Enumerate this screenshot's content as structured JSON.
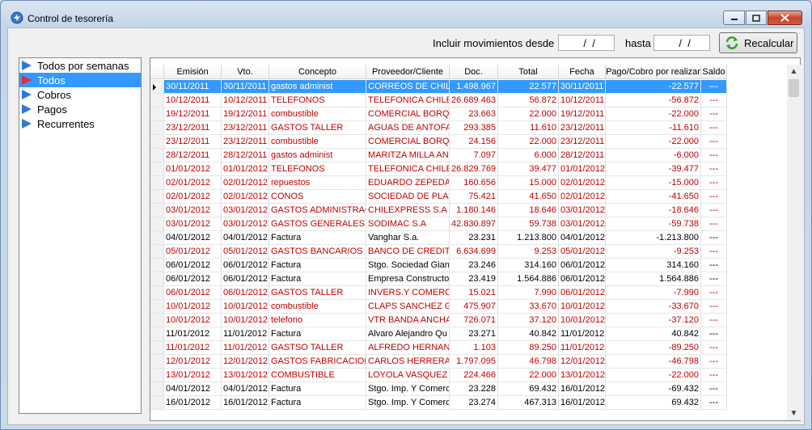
{
  "window": {
    "title": "Control de tesorería",
    "minimize_label": "▁",
    "maximize_label": "□",
    "close_label": "✕"
  },
  "filters": {
    "from_label": "Incluir movimientos desde",
    "from_value": "  /  /",
    "to_label": "hasta",
    "to_value": "  /  /",
    "recalc_label": "Recalcular"
  },
  "nav": {
    "items": [
      {
        "label": "Todos por semanas",
        "selected": false
      },
      {
        "label": "Todos",
        "selected": true
      },
      {
        "label": "Cobros",
        "selected": false
      },
      {
        "label": "Pagos",
        "selected": false
      },
      {
        "label": "Recurrentes",
        "selected": false
      }
    ]
  },
  "grid": {
    "columns": [
      "Emisión",
      "Vto.",
      "Concepto",
      "Proveedor/Cliente",
      "Doc.",
      "Total",
      "Fecha",
      "Pago/Cobro por realizar",
      "Saldo"
    ],
    "rows": [
      {
        "emision": "30/11/2011",
        "vto": "30/11/2011",
        "concepto": "gastos administ",
        "proveedor": "CORREOS DE CHILE",
        "doc": "1.498.967",
        "total": "22.577",
        "fecha": "30/11/2011",
        "pago": "-22.577",
        "saldo": "---",
        "color": "red",
        "selected": true
      },
      {
        "emision": "10/12/2011",
        "vto": "10/12/2011",
        "concepto": "TELEFONOS",
        "proveedor": "TELEFONICA CHILE S",
        "doc": "26.689.463",
        "total": "56.872",
        "fecha": "10/12/2011",
        "pago": "-56.872",
        "saldo": "---",
        "color": "red",
        "selected": false
      },
      {
        "emision": "19/12/2011",
        "vto": "19/12/2011",
        "concepto": "combustible",
        "proveedor": "COMERCIAL BORQU",
        "doc": "23.663",
        "total": "22.000",
        "fecha": "19/12/2011",
        "pago": "-22.000",
        "saldo": "---",
        "color": "red",
        "selected": false
      },
      {
        "emision": "23/12/2011",
        "vto": "23/12/2011",
        "concepto": "GASTOS TALLER",
        "proveedor": "AGUAS DE ANTOFA",
        "doc": "293.385",
        "total": "11.610",
        "fecha": "23/12/2011",
        "pago": "-11.610",
        "saldo": "---",
        "color": "red",
        "selected": false
      },
      {
        "emision": "23/12/2011",
        "vto": "23/12/2011",
        "concepto": "combustible",
        "proveedor": "COMERCIAL BORQU",
        "doc": "24.156",
        "total": "22.000",
        "fecha": "23/12/2011",
        "pago": "-22.000",
        "saldo": "---",
        "color": "red",
        "selected": false
      },
      {
        "emision": "28/12/2011",
        "vto": "28/12/2011",
        "concepto": "gastos administ",
        "proveedor": "MARITZA MILLA ANC",
        "doc": "7.097",
        "total": "6.000",
        "fecha": "28/12/2011",
        "pago": "-6.000",
        "saldo": "---",
        "color": "red",
        "selected": false
      },
      {
        "emision": "01/01/2012",
        "vto": "01/01/2012",
        "concepto": "TELEFONOS",
        "proveedor": "TELEFONICA CHILE S",
        "doc": "26.829.769",
        "total": "39.477",
        "fecha": "01/01/2012",
        "pago": "-39.477",
        "saldo": "---",
        "color": "red",
        "selected": false
      },
      {
        "emision": "02/01/2012",
        "vto": "02/01/2012",
        "concepto": "repuestos",
        "proveedor": "EDUARDO ZEPEDA I",
        "doc": "160.656",
        "total": "15.000",
        "fecha": "02/01/2012",
        "pago": "-15.000",
        "saldo": "---",
        "color": "red",
        "selected": false
      },
      {
        "emision": "02/01/2012",
        "vto": "02/01/2012",
        "concepto": "CONOS",
        "proveedor": "SOCIEDAD DE PLAS",
        "doc": "75.421",
        "total": "41.650",
        "fecha": "02/01/2012",
        "pago": "-41.650",
        "saldo": "---",
        "color": "red",
        "selected": false
      },
      {
        "emision": "03/01/2012",
        "vto": "03/01/2012",
        "concepto": "GASTOS ADMINISTRACI",
        "proveedor": "CHILEXPRESS S.A",
        "doc": "1.180.146",
        "total": "18.646",
        "fecha": "03/01/2012",
        "pago": "-18.646",
        "saldo": "---",
        "color": "red",
        "selected": false
      },
      {
        "emision": "03/01/2012",
        "vto": "03/01/2012",
        "concepto": "GASTOS GENERALES T.",
        "proveedor": "SODIMAC S.A",
        "doc": "42.830.897",
        "total": "59.738",
        "fecha": "03/01/2012",
        "pago": "-59.738",
        "saldo": "---",
        "color": "red",
        "selected": false
      },
      {
        "emision": "04/01/2012",
        "vto": "04/01/2012",
        "concepto": "Factura",
        "proveedor": "Vanghar S.a.",
        "doc": "23.231",
        "total": "1.213.800",
        "fecha": "04/01/2012",
        "pago": "-1.213.800",
        "saldo": "---",
        "color": "black",
        "selected": false
      },
      {
        "emision": "05/01/2012",
        "vto": "05/01/2012",
        "concepto": "GASTOS BANCARIOS",
        "proveedor": "BANCO DE CREDITO",
        "doc": "6.634.699",
        "total": "9.253",
        "fecha": "05/01/2012",
        "pago": "-9.253",
        "saldo": "---",
        "color": "red",
        "selected": false
      },
      {
        "emision": "06/01/2012",
        "vto": "06/01/2012",
        "concepto": "Factura",
        "proveedor": "Stgo. Sociedad Gian",
        "doc": "23.246",
        "total": "314.160",
        "fecha": "06/01/2012",
        "pago": "314.160",
        "saldo": "---",
        "color": "black",
        "selected": false
      },
      {
        "emision": "06/01/2012",
        "vto": "06/01/2012",
        "concepto": "Factura",
        "proveedor": "Empresa Constructo",
        "doc": "23.419",
        "total": "1.564.886",
        "fecha": "06/01/2012",
        "pago": "1.564.886",
        "saldo": "---",
        "color": "black",
        "selected": false
      },
      {
        "emision": "06/01/2012",
        "vto": "06/01/2012",
        "concepto": "GASTOS TALLER",
        "proveedor": "INVERS.Y COMERC.",
        "doc": "15.021",
        "total": "7.990",
        "fecha": "06/01/2012",
        "pago": "-7.990",
        "saldo": "---",
        "color": "red",
        "selected": false
      },
      {
        "emision": "10/01/2012",
        "vto": "10/01/2012",
        "concepto": "combustible",
        "proveedor": "CLAPS SANCHEZ G",
        "doc": "475.907",
        "total": "33.670",
        "fecha": "10/01/2012",
        "pago": "-33.670",
        "saldo": "---",
        "color": "red",
        "selected": false
      },
      {
        "emision": "10/01/2012",
        "vto": "10/01/2012",
        "concepto": "telefono",
        "proveedor": "VTR BANDA ANCHA",
        "doc": "726.071",
        "total": "37.120",
        "fecha": "10/01/2012",
        "pago": "-37.120",
        "saldo": "---",
        "color": "red",
        "selected": false
      },
      {
        "emision": "11/01/2012",
        "vto": "11/01/2012",
        "concepto": "Factura",
        "proveedor": "Alvaro Alejandro Qu",
        "doc": "23.271",
        "total": "40.842",
        "fecha": "11/01/2012",
        "pago": "40.842",
        "saldo": "---",
        "color": "black",
        "selected": false
      },
      {
        "emision": "11/01/2012",
        "vto": "11/01/2012",
        "concepto": "GASTSO TALLER",
        "proveedor": "ALFREDO HERNAND",
        "doc": "1.103",
        "total": "89.250",
        "fecha": "11/01/2012",
        "pago": "-89.250",
        "saldo": "---",
        "color": "red",
        "selected": false
      },
      {
        "emision": "12/01/2012",
        "vto": "12/01/2012",
        "concepto": "GASTOS FABRICACION",
        "proveedor": "CARLOS HERRERA .",
        "doc": "1.797.095",
        "total": "46.798",
        "fecha": "12/01/2012",
        "pago": "-46.798",
        "saldo": "---",
        "color": "red",
        "selected": false
      },
      {
        "emision": "13/01/2012",
        "vto": "13/01/2012",
        "concepto": "COMBUSTIBLE",
        "proveedor": "LOYOLA VASQUEZ",
        "doc": "224.466",
        "total": "22.000",
        "fecha": "13/01/2012",
        "pago": "-22.000",
        "saldo": "---",
        "color": "red",
        "selected": false
      },
      {
        "emision": "04/01/2012",
        "vto": "04/01/2012",
        "concepto": "Factura",
        "proveedor": "Stgo. Imp. Y Comerc",
        "doc": "23.228",
        "total": "69.432",
        "fecha": "16/01/2012",
        "pago": "-69.432",
        "saldo": "---",
        "color": "black",
        "selected": false
      },
      {
        "emision": "16/01/2012",
        "vto": "16/01/2012",
        "concepto": "Factura",
        "proveedor": "Stgo. Imp. Y Comerc",
        "doc": "23.274",
        "total": "467.313",
        "fecha": "16/01/2012",
        "pago": "69.432",
        "saldo": "---",
        "color": "black",
        "selected": false
      }
    ]
  },
  "scrollbar": {
    "up_icon": "▲",
    "down_icon": "▼"
  }
}
